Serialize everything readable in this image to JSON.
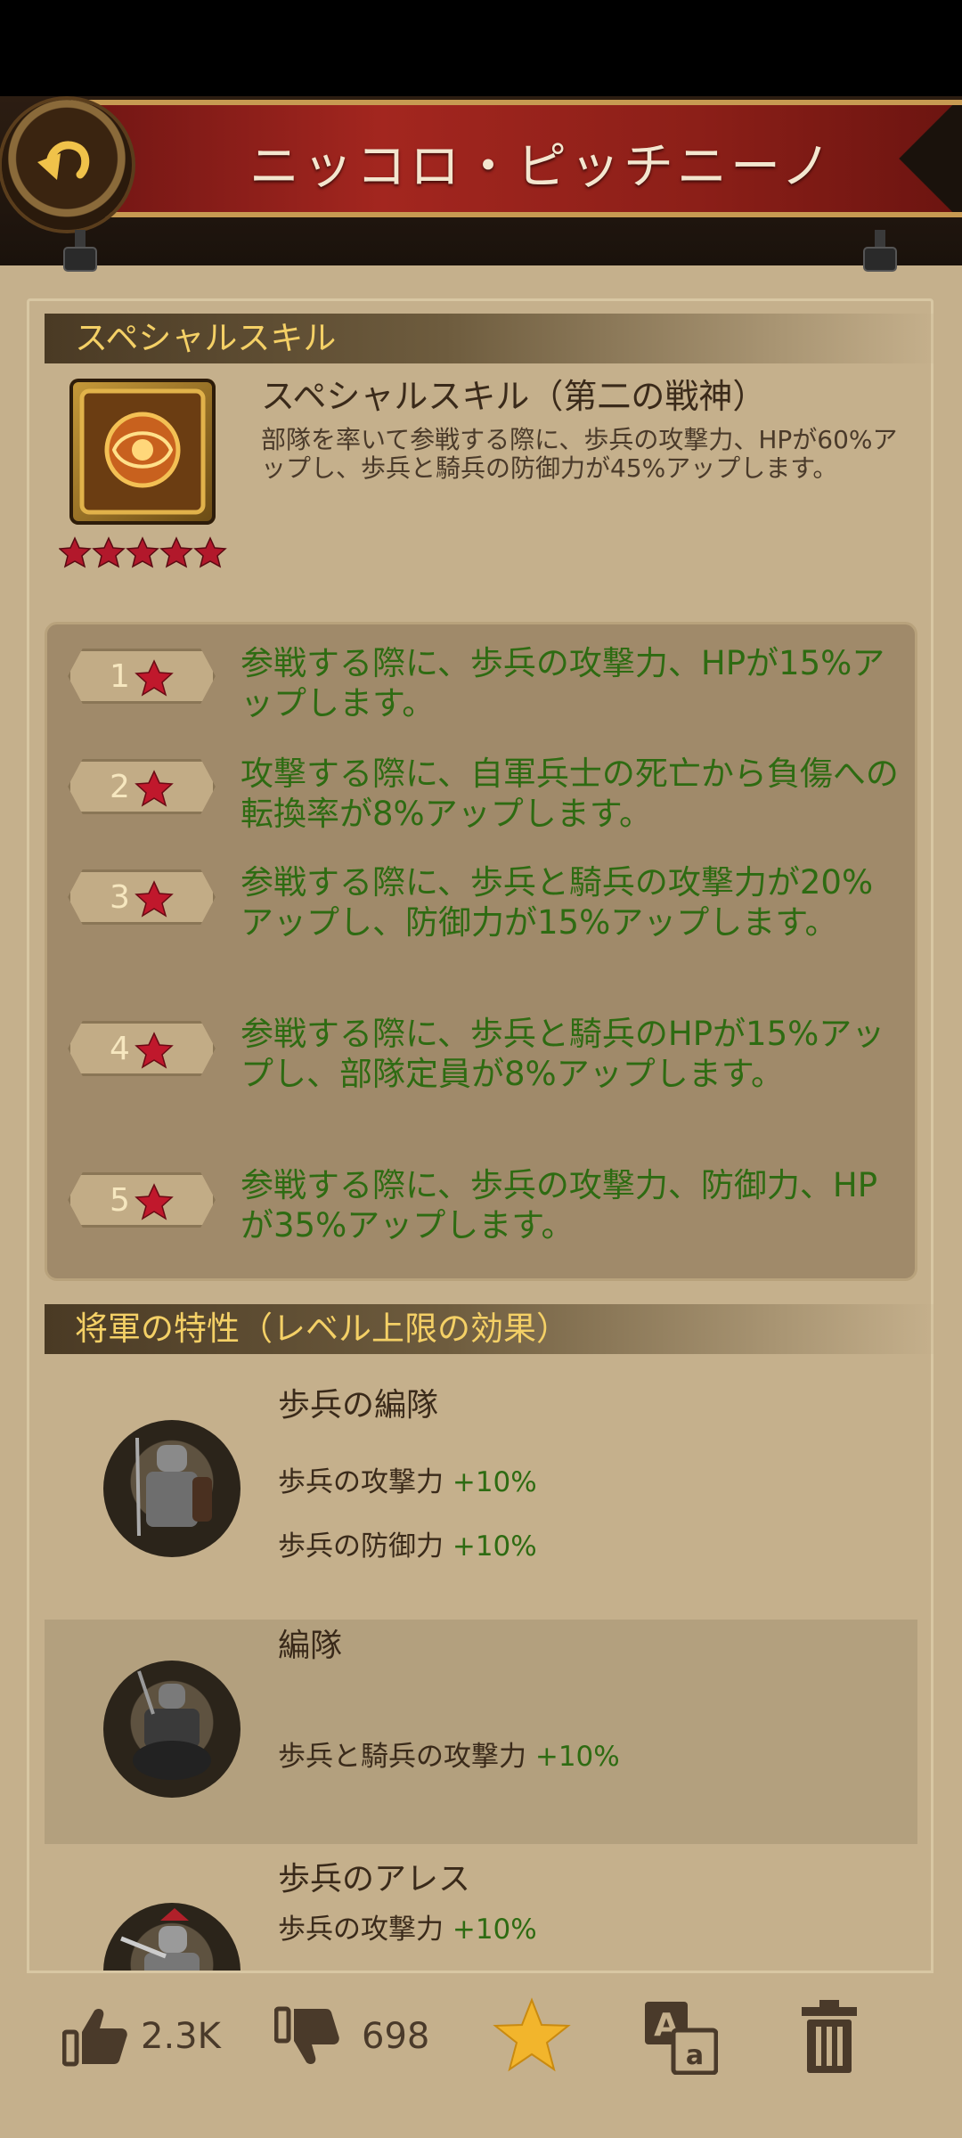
{
  "header": {
    "title": "ニッコロ・ピッチニーノ"
  },
  "sections": {
    "special_skill": "スペシャルスキル",
    "traits": "将軍の特性（レベル上限の効果）"
  },
  "skill": {
    "name": "スペシャルスキル（第二の戦神）",
    "description": "部隊を率いて参戦する際に、歩兵の攻撃力、HPが60%アップし、歩兵と騎兵の防御力が45%アップします。",
    "stars": 5
  },
  "levels": [
    {
      "num": "1",
      "text": "参戦する際に、歩兵の攻撃力、HPが15%アップします。"
    },
    {
      "num": "2",
      "text": "攻撃する際に、自軍兵士の死亡から負傷への転換率が8%アップします。"
    },
    {
      "num": "3",
      "text": "参戦する際に、歩兵と騎兵の攻撃力が20%アップし、防御力が15%アップします。"
    },
    {
      "num": "4",
      "text": "参戦する際に、歩兵と騎兵のHPが15%アップし、部隊定員が8%アップします。"
    },
    {
      "num": "5",
      "text": "参戦する際に、歩兵の攻撃力、防御力、HPが35%アップします。"
    }
  ],
  "traits": [
    {
      "name": "歩兵の編隊",
      "effects": [
        {
          "label": "歩兵の攻撃力",
          "value": "+10%"
        },
        {
          "label": "歩兵の防御力",
          "value": "+10%"
        }
      ]
    },
    {
      "name": "編隊",
      "effects": [
        {
          "label": "歩兵と騎兵の攻撃力",
          "value": "+10%"
        }
      ]
    },
    {
      "name": "歩兵のアレス",
      "effects": [
        {
          "label": "歩兵の攻撃力",
          "value": "+10%"
        }
      ]
    }
  ],
  "bottom": {
    "likes": "2.3K",
    "dislikes": "698"
  },
  "icons": {
    "back": "back-arrow-icon",
    "like": "thumbs-up-icon",
    "dislike": "thumbs-down-icon",
    "favorite": "star-icon",
    "translate": "translate-icon",
    "delete": "trash-icon"
  },
  "colors": {
    "banner": "#a3261f",
    "section_text": "#f4d066",
    "effect_green": "#2e6b12",
    "favorite_star": "#f2b52c"
  }
}
